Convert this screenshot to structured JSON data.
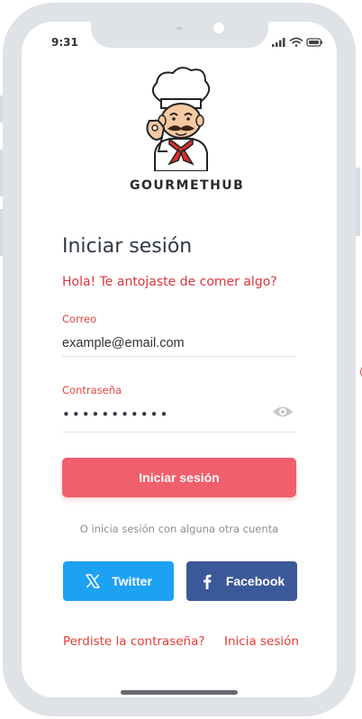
{
  "status_bar": {
    "time": "9:31"
  },
  "brand": {
    "name": "GOURMETHUB"
  },
  "login": {
    "title": "Iniciar sesión",
    "subtitle": "Hola! Te antojaste de comer algo?",
    "email_label": "Correo",
    "email_value": "example@email.com",
    "password_label": "Contraseña",
    "password_masked": "•••••••••••",
    "submit_label": "Iniciar sesión",
    "alt_text": "O inicia sesión con alguna otra cuenta",
    "twitter_label": "Twitter",
    "facebook_label": "Facebook",
    "forgot_label": "Perdiste la contraseña?",
    "signin_link_label": "Inicia sesión"
  },
  "colors": {
    "accent": "#f15f6c",
    "link": "#e43d36",
    "twitter": "#1da1f2",
    "facebook": "#3b5998",
    "frame": "#dfe2e6"
  },
  "icons": [
    "chef-logo",
    "eye-icon",
    "x-twitter-icon",
    "facebook-icon",
    "signal-icon",
    "wifi-icon",
    "battery-icon"
  ]
}
